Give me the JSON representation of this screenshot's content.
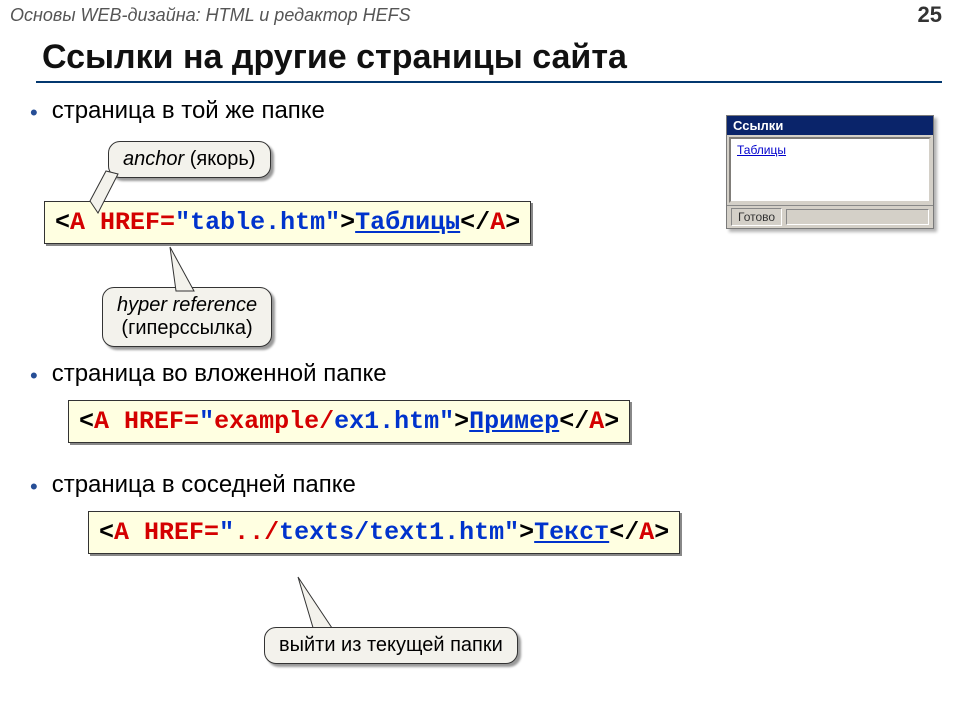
{
  "header": {
    "breadcrumb": "Основы WEB-дизайна: HTML и редактор HEFS",
    "page_number": "25"
  },
  "title": "Ссылки на другие страницы сайта",
  "bullets": {
    "b1": "страница в той же папке",
    "b2": "страница во вложенной папке",
    "b3": "страница в соседней папке"
  },
  "code1": {
    "p1": "<",
    "tag_a": "A",
    "sp": " ",
    "attr": "HREF=",
    "q": "\"",
    "val": "table.htm",
    "p2": ">",
    "link_text": "Таблицы",
    "p3": "</",
    "p4": ">"
  },
  "code2": {
    "p1": "<",
    "tag_a": "A",
    "sp": " ",
    "attr": "HREF=",
    "q": "\"",
    "val_pre": "example/",
    "val_file": "ex1.htm",
    "p2": ">",
    "link_text": "Пример",
    "p3": "</",
    "p4": ">"
  },
  "code3": {
    "p1": "<",
    "tag_a": "A",
    "sp": " ",
    "attr": "HREF=",
    "q": "\"",
    "val_pre": "../",
    "val_rest": "texts/text1.htm",
    "p2": ">",
    "link_text": "Текст",
    "p3": "</",
    "p4": ">"
  },
  "callouts": {
    "anchor_it": "anchor",
    "anchor_ru": " (якорь)",
    "hyper_l1": "hyper reference",
    "hyper_l2": "(гиперссылка)",
    "exit": "выйти из текущей папки"
  },
  "preview": {
    "title": "Ссылки",
    "link": "Таблицы",
    "status": "Готово"
  }
}
